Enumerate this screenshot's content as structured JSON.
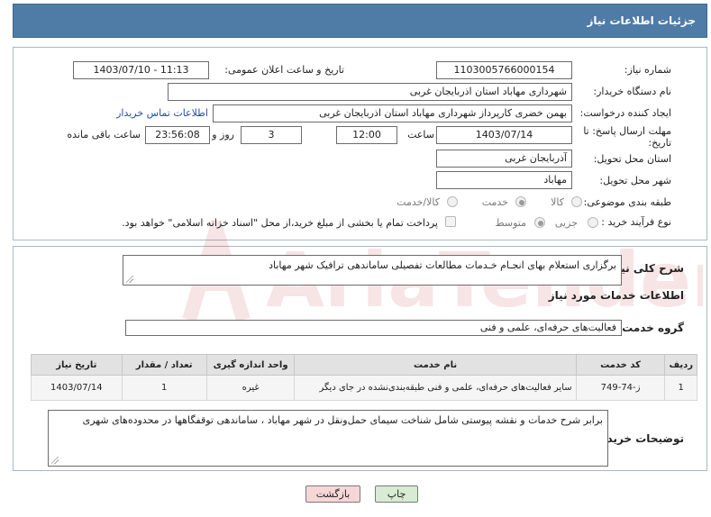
{
  "header": {
    "title": "جزئیات اطلاعات نیاز"
  },
  "form": {
    "need_number": {
      "label": "شماره نیاز:",
      "value": "1103005766000154"
    },
    "announce_datetime": {
      "label": "تاریخ و ساعت اعلان عمومی:",
      "value": "1403/07/10 - 11:13"
    },
    "buyer_org": {
      "label": "نام دستگاه خریدار:",
      "value": "شهرداری مهاباد استان اذربایجان غربی"
    },
    "requester": {
      "label": "ایجاد کننده درخواست:",
      "value": "بهمن خضری کارپرداز شهرداری مهاباد استان اذربایجان غربی",
      "contact_link": "اطلاعات تماس خریدار"
    },
    "deadline": {
      "label_line1": "مهلت ارسال پاسخ: تا",
      "label_line2": "تاریخ:",
      "date": "1403/07/14",
      "time_label": "ساعت",
      "time": "12:00",
      "days": "3",
      "days_label": "روز و",
      "remaining": "23:56:08",
      "remaining_label": "ساعت باقی مانده"
    },
    "province": {
      "label": "استان محل تحویل:",
      "value": "آذربایجان غربی"
    },
    "city": {
      "label": "شهر محل تحویل:",
      "value": "مهاباد"
    },
    "category": {
      "label": "طبقه بندی موضوعی:",
      "options": [
        "کالا",
        "خدمت",
        "کالا/خدمت"
      ],
      "selected": "خدمت"
    },
    "process": {
      "label": "نوع فرآیند خرید :",
      "options": [
        "جزیی",
        "متوسط"
      ],
      "selected": "متوسط",
      "treasury_note": "پرداخت تمام یا بخشی از مبلغ خرید،از محل \"اسناد خزانه اسلامی\" خواهد بود."
    }
  },
  "summary": {
    "label": "شرح کلی نیاز:",
    "value": "برگزاری استعلام بهای انجـام خـدمات مطالعات تفصیلی ساماندهی ترافیک شهر مهاباد"
  },
  "services": {
    "section_title": "اطلاعات خدمات مورد نیاز",
    "group_label": "گروه خدمت:",
    "group_value": "فعالیت‌های حرفه‌ای، علمی و فنی",
    "columns": [
      "ردیف",
      "کد خدمت",
      "نام خدمت",
      "واحد اندازه گیری",
      "تعداد / مقدار",
      "تاریخ نیاز"
    ],
    "rows": [
      {
        "row": "1",
        "code": "ز-74-749",
        "name": "سایر فعالیت‌های حرفه‌ای، علمی و فنی طبقه‌بندی‌نشده در جای دیگر",
        "unit": "غیره",
        "qty": "1",
        "date": "1403/07/14"
      }
    ]
  },
  "buyer_notes": {
    "label": "توضیحات خریدار:",
    "value": "برابر شرح خدمات و نقشه پیوستی شامل شناخت سیمای حمل‌ونقل در شهر مهاباد ، ساماندهی توقفگاهها در محدوده‌های شهری"
  },
  "buttons": {
    "print": "چاپ",
    "back": "بازگشت"
  },
  "watermark": {
    "text": "AriaTender.neT"
  },
  "colors": {
    "header_bg": "#4f7ba7",
    "link": "#1f4fa6",
    "back_button": "#f6d6d6",
    "print_button": "#d7ecd2",
    "watermark": "#c1121f"
  }
}
